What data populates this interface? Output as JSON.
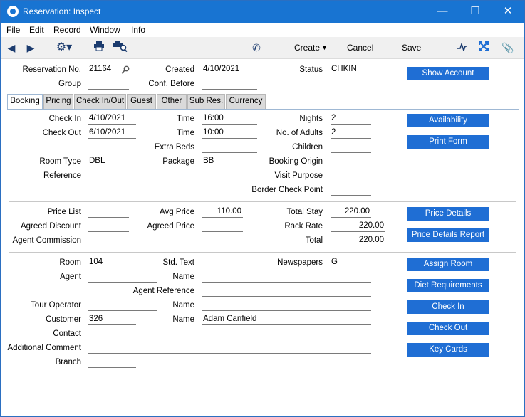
{
  "window": {
    "title": "Reservation: Inspect"
  },
  "menu": [
    "File",
    "Edit",
    "Record",
    "Window",
    "Info"
  ],
  "toolbar": {
    "create": "Create",
    "cancel": "Cancel",
    "save": "Save"
  },
  "header": {
    "reservation_no_label": "Reservation No.",
    "reservation_no": "21164",
    "created_label": "Created",
    "created": "4/10/2021",
    "status_label": "Status",
    "status": "CHKIN",
    "group_label": "Group",
    "group": "",
    "conf_before_label": "Conf. Before",
    "conf_before": ""
  },
  "tabs": [
    "Booking",
    "Pricing",
    "Check In/Out",
    "Guest",
    "Other",
    "Sub Res.",
    "Currency"
  ],
  "booking": {
    "check_in_label": "Check In",
    "check_in": "4/10/2021",
    "time1_label": "Time",
    "time1": "16:00",
    "nights_label": "Nights",
    "nights": "2",
    "check_out_label": "Check Out",
    "check_out": "6/10/2021",
    "time2_label": "Time",
    "time2": "10:00",
    "adults_label": "No. of Adults",
    "adults": "2",
    "extra_beds_label": "Extra Beds",
    "extra_beds": "",
    "children_label": "Children",
    "children": "",
    "room_type_label": "Room Type",
    "room_type": "DBL",
    "package_label": "Package",
    "package": "BB",
    "booking_origin_label": "Booking Origin",
    "booking_origin": "",
    "reference_label": "Reference",
    "reference": "",
    "visit_purpose_label": "Visit Purpose",
    "visit_purpose": "",
    "border_label": "Border Check Point",
    "border": ""
  },
  "pricing": {
    "price_list_label": "Price List",
    "price_list": "",
    "avg_price_label": "Avg Price",
    "avg_price": "110.00",
    "total_stay_label": "Total Stay",
    "total_stay": "220.00",
    "agreed_discount_label": "Agreed Discount",
    "agreed_discount": "",
    "agreed_price_label": "Agreed Price",
    "agreed_price": "",
    "rack_rate_label": "Rack Rate",
    "rack_rate": "220.00",
    "agent_commission_label": "Agent Commission",
    "agent_commission": "",
    "total_label": "Total",
    "total": "220.00"
  },
  "guest": {
    "room_label": "Room",
    "room": "104",
    "std_text_label": "Std. Text",
    "std_text": "",
    "newspapers_label": "Newspapers",
    "newspapers": "G",
    "agent_label": "Agent",
    "agent": "",
    "name1_label": "Name",
    "name1": "",
    "agent_ref_label": "Agent Reference",
    "agent_ref": "",
    "tour_operator_label": "Tour Operator",
    "tour_operator": "",
    "name2_label": "Name",
    "name2": "",
    "customer_label": "Customer",
    "customer": "326",
    "name3_label": "Name",
    "name3": "Adam Canfield",
    "contact_label": "Contact",
    "contact": "",
    "comment_label": "Additional Comment",
    "comment": "",
    "branch_label": "Branch",
    "branch": ""
  },
  "buttons": {
    "show_account": "Show Account",
    "availability": "Availability",
    "print_form": "Print Form",
    "price_details": "Price Details",
    "price_details_report": "Price Details Report",
    "assign_room": "Assign Room",
    "diet": "Diet Requirements",
    "check_in": "Check In",
    "check_out": "Check Out",
    "key_cards": "Key Cards"
  },
  "colors": {
    "titlebar": "#1874d2",
    "button": "#1f6ed4",
    "toolbar": "#f0f0f0"
  }
}
